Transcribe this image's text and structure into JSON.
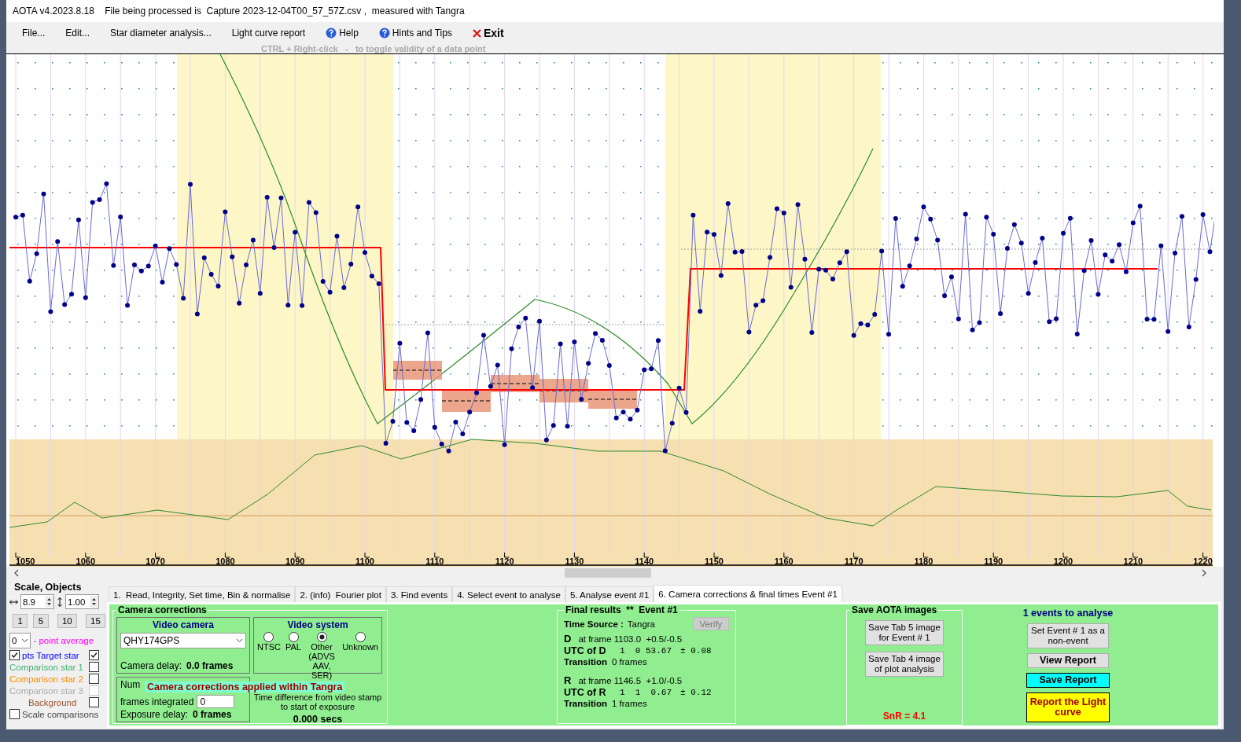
{
  "window": {
    "title": "AOTA v4.2023.8.18    File being processed is  Capture 2023-12-04T00_57_57Z.csv ,  measured with Tangra"
  },
  "menu": [
    {
      "label": "File...",
      "kind": "plain"
    },
    {
      "label": "Edit...",
      "kind": "plain"
    },
    {
      "label": "Star diameter analysis...",
      "kind": "plain"
    },
    {
      "label": "Light curve report",
      "kind": "plain"
    },
    {
      "label": "Help",
      "kind": "help"
    },
    {
      "label": "Hints and Tips",
      "kind": "help"
    },
    {
      "label": "Exit",
      "kind": "exit"
    }
  ],
  "hint": "CTRL + Right-click   -   to toggle validity of a data point",
  "plot": {
    "x_tick_labels": [
      "1050",
      "1060",
      "1070",
      "1080",
      "1090",
      "1100",
      "1110",
      "1120",
      "1130",
      "1140",
      "1150",
      "1160",
      "1170",
      "1180",
      "1190",
      "1200",
      "1210",
      "1220"
    ]
  },
  "scale_panel": {
    "title": "Scale,  Objects",
    "x_scale": "8.9",
    "y_scale": "1.00",
    "quick_buttons": [
      "1",
      "5",
      "10",
      "15"
    ],
    "average": {
      "value": "0",
      "label": "- point average"
    },
    "pts": {
      "label": "pts",
      "checked": true
    },
    "stars": [
      {
        "label": "Target star",
        "color": "#0000ff",
        "checked": true,
        "disabled": false
      },
      {
        "label": "Comparison star 1",
        "color": "#3cb371",
        "checked": false,
        "disabled": false
      },
      {
        "label": "Comparison star 2",
        "color": "#ff8c00",
        "checked": false,
        "disabled": false
      },
      {
        "label": "Comparison star 3",
        "color": "#a9a9a9",
        "checked": false,
        "disabled": true
      },
      {
        "label": "Background",
        "color": "#a0522d",
        "checked": false,
        "disabled": false
      }
    ],
    "scale_comparisons": {
      "label": "Scale comparisons",
      "checked": false
    }
  },
  "tabs": [
    {
      "label": "1.  Read, Integrity, Set time, Bin & normalise",
      "selected": false
    },
    {
      "label": "2. (info)  Fourier plot",
      "selected": false
    },
    {
      "label": "3. Find events",
      "selected": false
    },
    {
      "label": "4. Select event to analyse",
      "selected": false
    },
    {
      "label": "5. Analyse event #1",
      "selected": false
    },
    {
      "label": "6. Camera corrections & final times Event #1",
      "selected": true
    }
  ],
  "camera_corrections": {
    "title": "Camera corrections",
    "video_camera": {
      "title": "Video camera",
      "value": "QHY174GPS",
      "delay_label": "Camera delay:",
      "delay": "0.0 frames"
    },
    "video_system": {
      "title": "Video system",
      "options": [
        {
          "label": "NTSC",
          "selected": false
        },
        {
          "label": "PAL",
          "selected": false
        },
        {
          "label": "Other (ADVS AAV, SER)",
          "selected": true
        },
        {
          "label": "Unknown",
          "selected": false
        }
      ]
    },
    "integration": {
      "label_start": "Num",
      "label": "frames integrated",
      "value": "0",
      "delay_label": "Exposure delay:",
      "delay": "0 frames"
    },
    "time_difference": {
      "label": "Time difference from video stamp to start of exposure",
      "value": "0.000 secs"
    },
    "overlay": "Camera corrections applied within Tangra"
  },
  "final_results": {
    "title": "Final results  **  Event #1",
    "time_source_label": "Time Source :",
    "time_source": "Tangra",
    "verify": "Verify",
    "events": [
      {
        "edge": "D",
        "frame": "at frame 1103.0  +0.5/-0.5",
        "utc_label": "UTC of D",
        "utc": "1  0 53.67",
        "uncertainty": "± 0.08",
        "transition_label": "Transition",
        "transition": "0 frames"
      },
      {
        "edge": "R",
        "frame": "at frame 1146.5  +1.0/-0.5",
        "utc_label": "UTC of R",
        "utc": "1  1  0.67",
        "uncertainty": "± 0.12",
        "transition_label": "Transition",
        "transition": "1 frames"
      }
    ]
  },
  "save_images": {
    "title": "Save AOTA images",
    "buttons": [
      "Save Tab 5 image for Event # 1",
      "Save Tab 4 image of plot analysis"
    ],
    "snr": "SnR = 4.1"
  },
  "events_panel": {
    "title": "1 events to analyse",
    "buttons": [
      {
        "label": "Set Event # 1 as a non-event",
        "kind": "plain"
      },
      {
        "label": "View Report",
        "kind": "bold"
      },
      {
        "label": "Save Report",
        "kind": "save"
      },
      {
        "label": "Report the Light curve",
        "kind": "report"
      }
    ]
  }
}
